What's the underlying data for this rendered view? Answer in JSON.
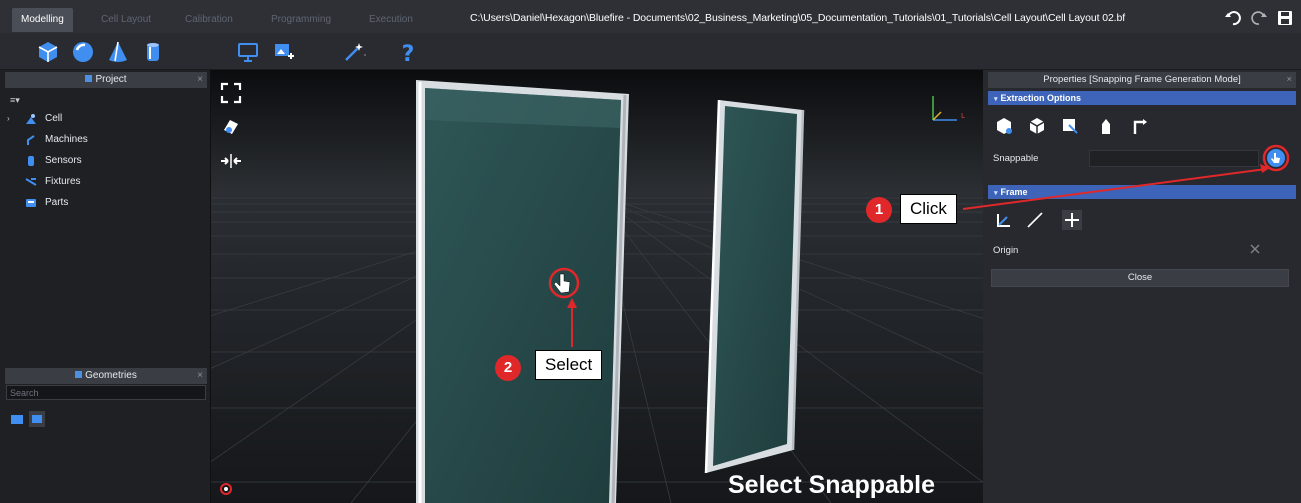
{
  "window": {
    "file_path": "C:\\Users\\Daniel\\Hexagon\\Bluefire - Documents\\02_Business_Marketing\\05_Documentation_Tutorials\\01_Tutorials\\Cell Layout\\Cell Layout 02.bf",
    "title_icons": [
      "undo-icon",
      "redo-icon",
      "save-icon"
    ]
  },
  "tabs": [
    {
      "label": "Modelling",
      "active": true
    },
    {
      "label": "Cell Layout",
      "active": false
    },
    {
      "label": "Calibration",
      "active": false
    },
    {
      "label": "Programming",
      "active": false
    },
    {
      "label": "Execution",
      "active": false
    }
  ],
  "toolbar": {
    "icons": [
      "cube-icon",
      "sphere-icon",
      "cone-icon",
      "cylinder-icon",
      "monitor-icon",
      "image-add-icon",
      "magic-wand-icon",
      "help-icon"
    ]
  },
  "project_panel": {
    "title": "Project",
    "items": [
      {
        "label": "Cell",
        "icon": "cell-icon"
      },
      {
        "label": "Machines",
        "icon": "robot-arm-icon"
      },
      {
        "label": "Sensors",
        "icon": "sensor-icon"
      },
      {
        "label": "Fixtures",
        "icon": "fixture-icon"
      },
      {
        "label": "Parts",
        "icon": "part-icon"
      }
    ],
    "search_placeholder": "Search"
  },
  "geometries_panel": {
    "title": "Geometries"
  },
  "viewport": {
    "caption": "Select Snappable",
    "buttons": [
      "fit-view-icon",
      "camera-icon",
      "align-icon"
    ]
  },
  "properties_panel": {
    "title": "Properties [Snapping Frame Generation Mode]",
    "extraction_section": "Extraction Options",
    "snappable_label": "Snappable",
    "frame_section": "Frame",
    "origin_label": "Origin",
    "close_label": "Close"
  },
  "annotations": [
    {
      "number": "1",
      "label": "Click"
    },
    {
      "number": "2",
      "label": "Select"
    }
  ],
  "colors": {
    "accent": "#3d64b9",
    "annotation": "#e0282b",
    "panel_glass": "#2a4a4a"
  }
}
